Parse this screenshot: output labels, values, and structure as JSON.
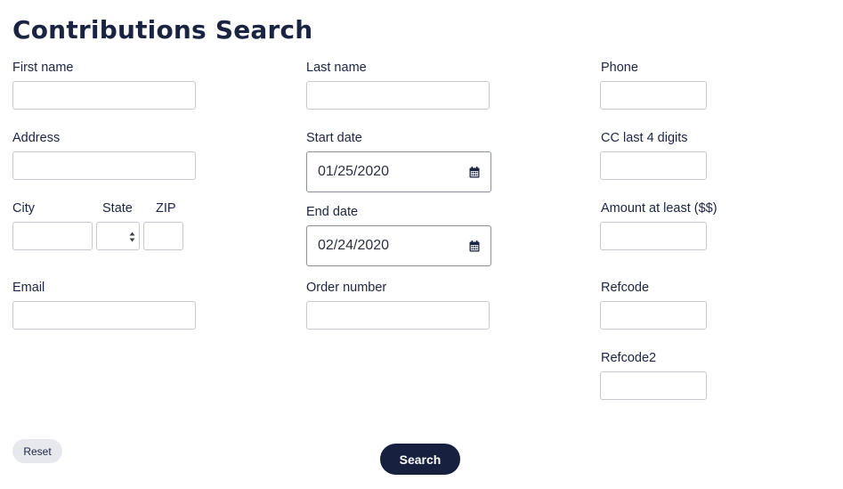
{
  "page": {
    "title": "Contributions Search"
  },
  "form": {
    "first_name": {
      "label": "First name",
      "value": ""
    },
    "address": {
      "label": "Address",
      "value": ""
    },
    "city": {
      "label": "City",
      "value": ""
    },
    "state": {
      "label": "State",
      "value": ""
    },
    "zip": {
      "label": "ZIP",
      "value": ""
    },
    "email": {
      "label": "Email",
      "value": ""
    },
    "last_name": {
      "label": "Last name",
      "value": ""
    },
    "start_date": {
      "label": "Start date",
      "value": "01/25/2020",
      "icon": "calendar-icon"
    },
    "end_date": {
      "label": "End date",
      "value": "02/24/2020",
      "icon": "calendar-icon"
    },
    "order_number": {
      "label": "Order number",
      "value": ""
    },
    "phone": {
      "label": "Phone",
      "value": ""
    },
    "cc_last4": {
      "label": "CC last 4 digits",
      "value": ""
    },
    "amount_min": {
      "label": "Amount at least ($$)",
      "value": ""
    },
    "refcode": {
      "label": "Refcode",
      "value": ""
    },
    "refcode2": {
      "label": "Refcode2",
      "value": ""
    }
  },
  "actions": {
    "reset_label": "Reset",
    "search_label": "Search"
  },
  "colors": {
    "primary": "#17213f",
    "text": "#1c2540",
    "border": "#c6c9cf",
    "reset_bg": "#e6e8ed"
  }
}
